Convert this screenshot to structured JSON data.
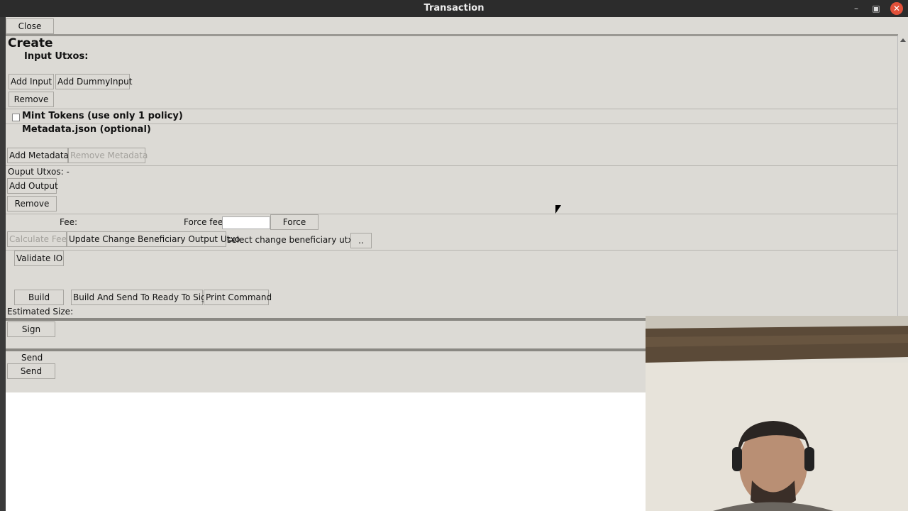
{
  "window": {
    "title": "Transaction",
    "minimize_icon": "minimize-icon",
    "maximize_icon": "maximize-icon",
    "close_icon": "close-icon"
  },
  "toolbar": {
    "close_label": "Close"
  },
  "create": {
    "header": "Create",
    "input_utxos_label": "Input Utxos:",
    "add_input_label": "Add Input",
    "add_dummy_input_label": "Add DummyInput",
    "remove_label": "Remove",
    "mint_tokens_label": "Mint Tokens (use only 1 policy)",
    "metadata_label": "Metadata.json (optional)",
    "add_metadata_label": "Add Metadata",
    "remove_metadata_label": "Remove Metadata",
    "output_utxos_label": "Ouput Utxos: -",
    "add_output_label": "Add Output",
    "remove_output_label": "Remove",
    "fee_label": "Fee:",
    "force_fee_label": "Force fee",
    "force_fee_value": "",
    "force_label": "Force",
    "calculate_fee_label": "Calculate Fee",
    "update_change_label": "Update Change Beneficiary Output Utxo",
    "select_change_label": "select change beneficiary utxo:",
    "select_change_button_label": "..",
    "validate_io_label": "Validate IO",
    "build_label": "Build",
    "build_send_label": "Build And Send To Ready To Sign",
    "print_command_label": "Print Command",
    "estimated_size_label": "Estimated Size:"
  },
  "sign": {
    "sign_label": "Sign"
  },
  "send": {
    "send_section_label": "Send",
    "send_label": "Send"
  },
  "colors": {
    "panel": "#dcdad5",
    "titlebar": "#2c2c2c",
    "close": "#e2513a"
  }
}
